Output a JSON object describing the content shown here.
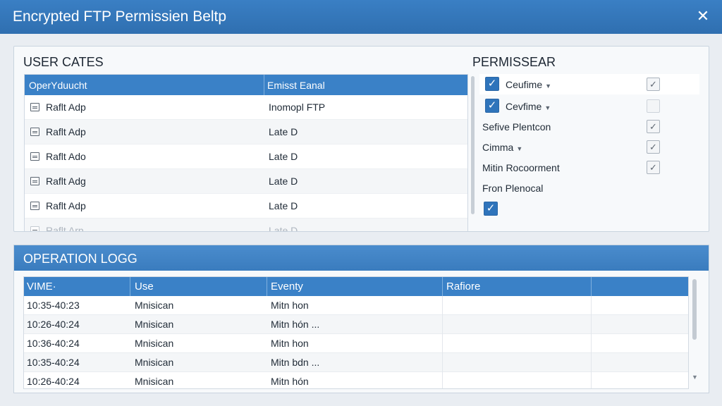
{
  "window": {
    "title": "Encrypted FTP Permissien Beltp",
    "close_glyph": "✕"
  },
  "users": {
    "title": "USER CATES",
    "columns": [
      "OperYduucht",
      "Emisst Eanal"
    ],
    "rows": [
      {
        "name": "Raflt Adp",
        "value": "Inomopl FTP"
      },
      {
        "name": "Raflt Adp",
        "value": "Late D"
      },
      {
        "name": "Raflt Ado",
        "value": "Late D"
      },
      {
        "name": "Raflt Adg",
        "value": "Late D"
      },
      {
        "name": "Raflt Adp",
        "value": "Late D"
      },
      {
        "name": "Raflt Arp",
        "value": "Late D"
      }
    ]
  },
  "permissions": {
    "title": "PERMISSEAR",
    "items": [
      {
        "label": "Ceufime",
        "left_checked": true,
        "dropdown": true,
        "right_box": "checked"
      },
      {
        "label": "Cevfime",
        "left_checked": true,
        "dropdown": true,
        "right_box": "empty"
      },
      {
        "label": "Sefive Plentcon",
        "left_checked": false,
        "dropdown": false,
        "right_box": "checked"
      },
      {
        "label": "Cimma",
        "left_checked": false,
        "dropdown": true,
        "right_box": "checked"
      },
      {
        "label": "Mitin Rocoorment",
        "left_checked": false,
        "dropdown": false,
        "right_box": "checked"
      },
      {
        "label": "Fron Plenocal",
        "left_checked": false,
        "dropdown": false,
        "right_box": "none"
      }
    ],
    "standalone_checked": true
  },
  "log": {
    "title": "OPERATION LOGG",
    "columns": [
      "VIME·",
      "Use",
      "Eventy",
      "Rafiore",
      ""
    ],
    "rows": [
      {
        "time": "10:35-40:23",
        "user": "Mnisican",
        "event": "Mitn hon"
      },
      {
        "time": "10:26-40:24",
        "user": "Mnisican",
        "event": "Mitn hón ..."
      },
      {
        "time": "10:36-40:24",
        "user": "Mnisican",
        "event": "Mitn hon"
      },
      {
        "time": "10:35-40:24",
        "user": "Mnisican",
        "event": "Mitn bdn ..."
      },
      {
        "time": "10:26-40:24",
        "user": "Mnisican",
        "event": "Mitn hón"
      }
    ]
  },
  "colors": {
    "accent": "#3a81c7",
    "titlebar": "#2f6fb0",
    "checkbox": "#2f74bb"
  },
  "icons": {
    "close": "close-icon",
    "row": "file-icon",
    "dropdown": "caret-down-icon",
    "check": "checkmark-icon"
  }
}
